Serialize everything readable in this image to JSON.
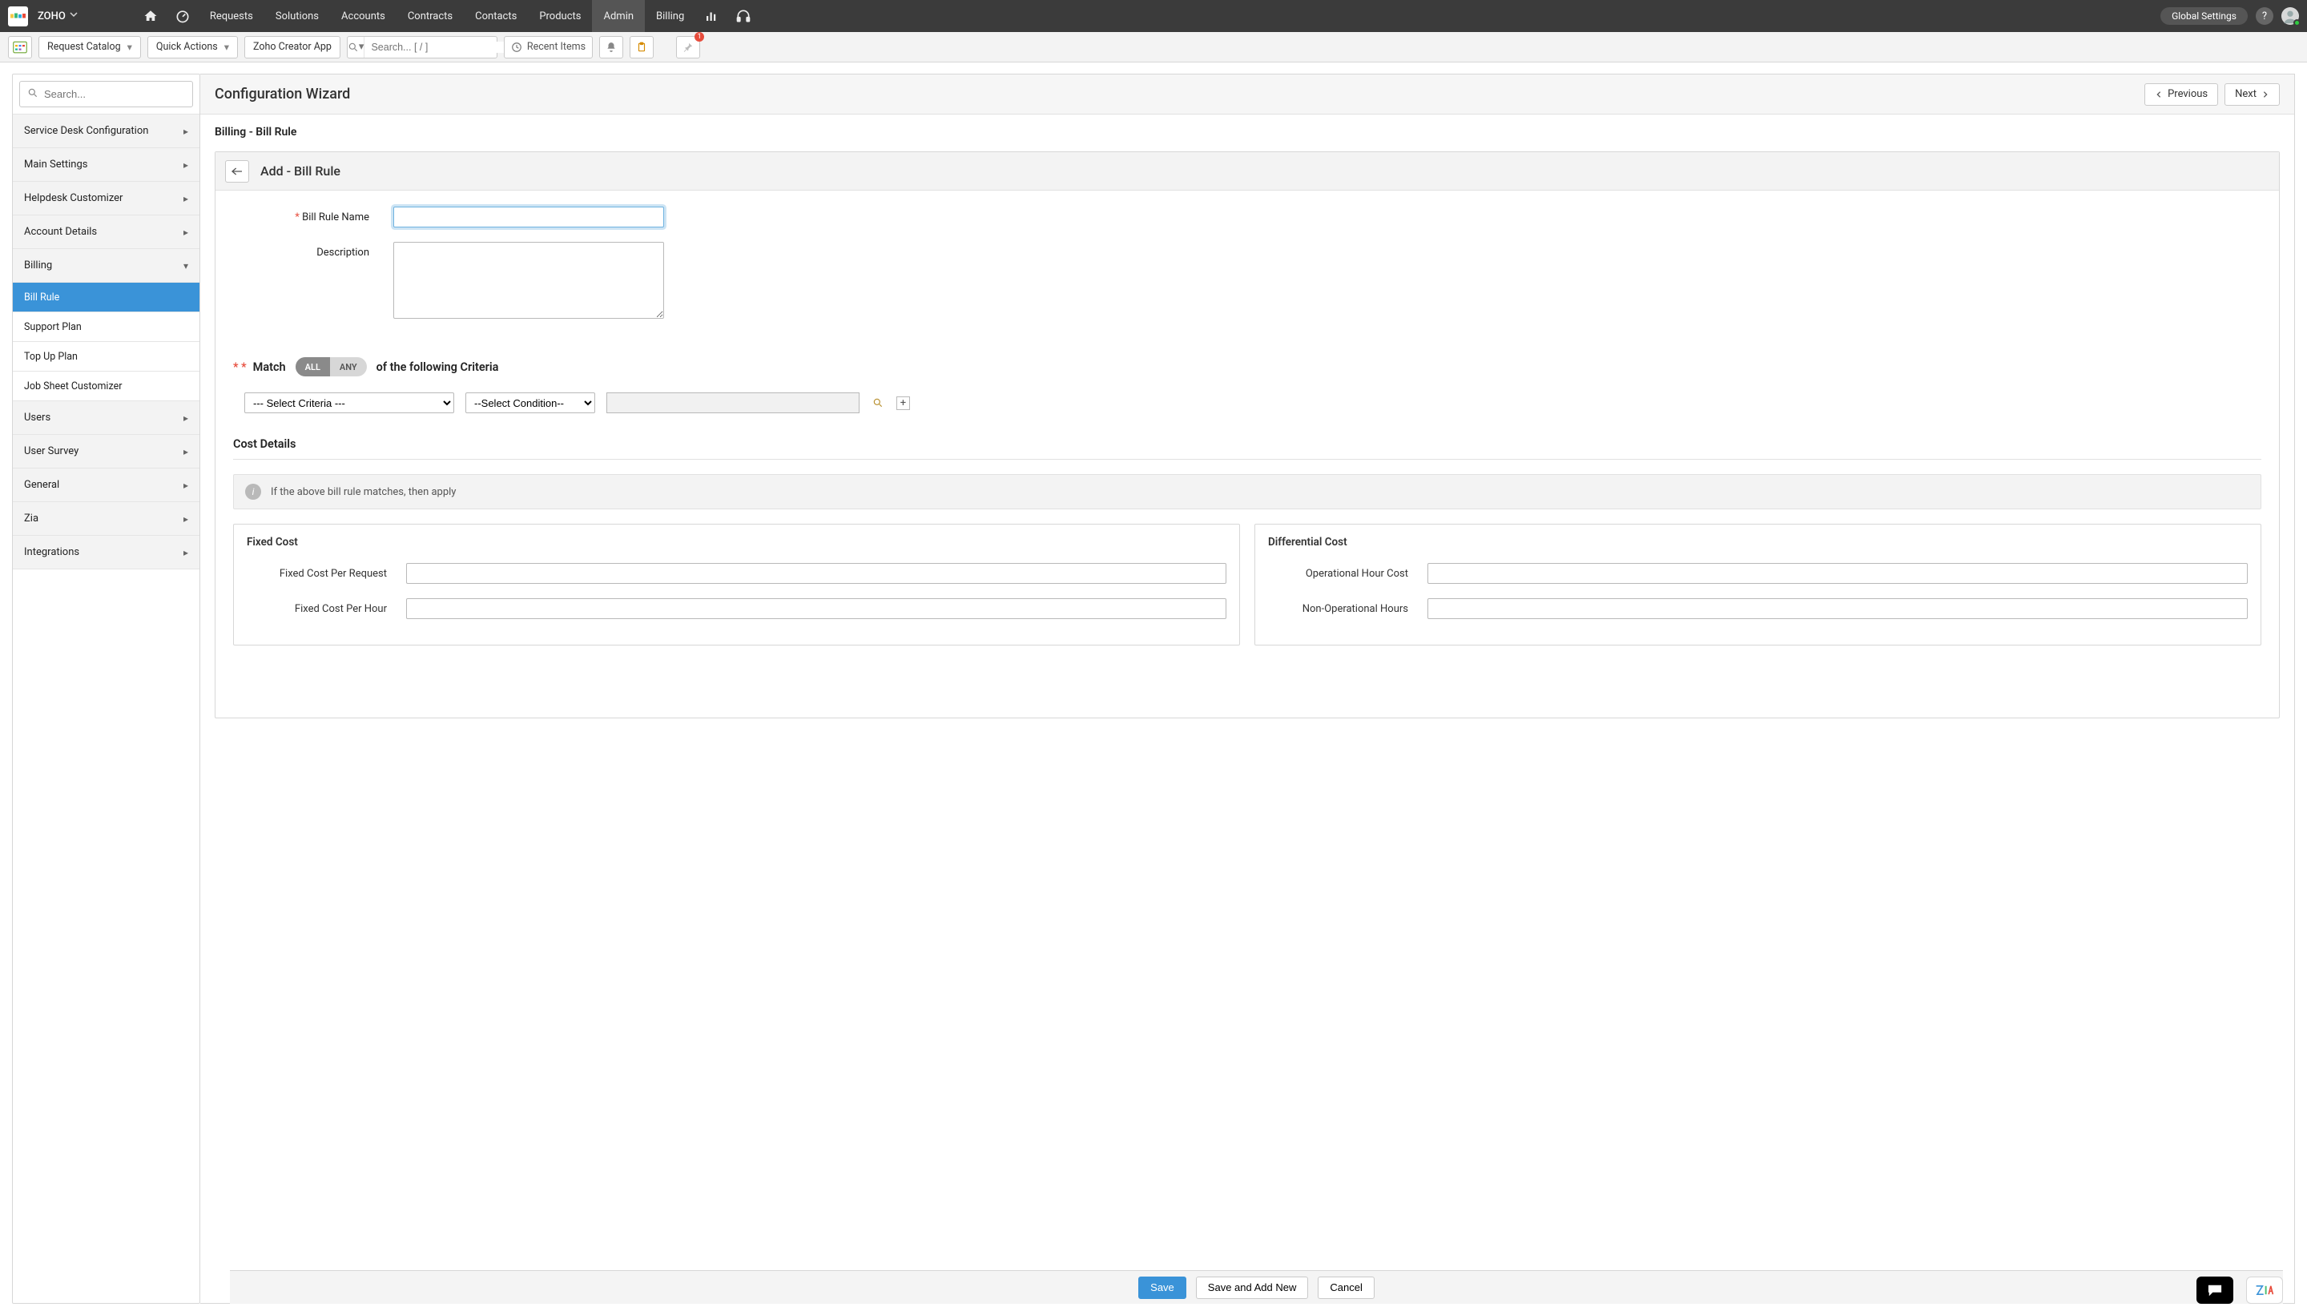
{
  "brand": {
    "name": "ZOHO"
  },
  "topnav": {
    "items": [
      "Requests",
      "Solutions",
      "Accounts",
      "Contracts",
      "Contacts",
      "Products",
      "Admin",
      "Billing"
    ],
    "active_index": 6,
    "global_settings": "Global Settings"
  },
  "toolbar": {
    "request_catalog": "Request Catalog",
    "quick_actions": "Quick Actions",
    "zoho_creator": "Zoho Creator App",
    "search_placeholder": "Search... [ / ]",
    "recent_items": "Recent Items",
    "pin_badge": "1"
  },
  "sidebar": {
    "search_placeholder": "Search...",
    "groups": [
      {
        "label": "Service Desk Configuration",
        "expandable": true,
        "expanded": false
      },
      {
        "label": "Main Settings",
        "expandable": true,
        "expanded": false
      },
      {
        "label": "Helpdesk Customizer",
        "expandable": true,
        "expanded": false
      },
      {
        "label": "Account Details",
        "expandable": true,
        "expanded": false
      },
      {
        "label": "Billing",
        "expandable": true,
        "expanded": true
      },
      {
        "label": "Users",
        "expandable": true,
        "expanded": false
      },
      {
        "label": "User Survey",
        "expandable": true,
        "expanded": false
      },
      {
        "label": "General",
        "expandable": true,
        "expanded": false
      },
      {
        "label": "Zia",
        "expandable": true,
        "expanded": false
      },
      {
        "label": "Integrations",
        "expandable": true,
        "expanded": false
      }
    ],
    "billing_children": [
      {
        "label": "Bill Rule",
        "active": true
      },
      {
        "label": "Support Plan",
        "active": false
      },
      {
        "label": "Top Up Plan",
        "active": false
      },
      {
        "label": "Job Sheet Customizer",
        "active": false
      }
    ]
  },
  "main": {
    "title": "Configuration Wizard",
    "previous": "Previous",
    "next": "Next",
    "breadcrumb": "Billing -  Bill Rule",
    "panel_title": "Add - Bill Rule",
    "labels": {
      "bill_rule_name": "Bill Rule Name",
      "description": "Description"
    },
    "match": {
      "prefix": "Match",
      "all": "ALL",
      "any": "ANY",
      "suffix": "of the following Criteria"
    },
    "criteria": {
      "select_criteria": "--- Select Criteria ---",
      "select_condition": "--Select Condition--"
    },
    "cost": {
      "heading": "Cost Details",
      "info": "If the above bill rule matches, then apply",
      "fixed": {
        "title": "Fixed Cost",
        "per_request": "Fixed Cost Per Request",
        "per_hour": "Fixed Cost Per Hour"
      },
      "diff": {
        "title": "Differential Cost",
        "op_hour": "Operational Hour Cost",
        "non_op_hours": "Non-Operational Hours"
      }
    }
  },
  "footer": {
    "save": "Save",
    "save_add_new": "Save and Add New",
    "cancel": "Cancel"
  }
}
